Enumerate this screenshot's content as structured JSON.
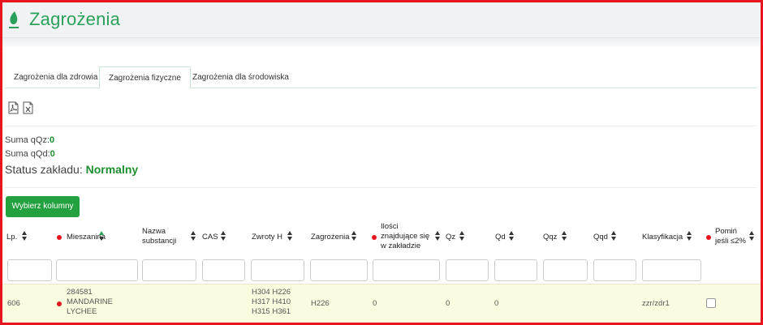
{
  "page": {
    "title": "Zagrożenia"
  },
  "tabs": [
    {
      "label": "Zagrożenia dla zdrowia",
      "active": false
    },
    {
      "label": "Zagrożenia fizyczne",
      "active": true
    },
    {
      "label": "Zagrożenia dla środowiska",
      "active": false
    }
  ],
  "toolbar": {
    "pdf_icon": "pdf-file-icon",
    "excel_icon": "excel-file-icon"
  },
  "summary": {
    "qqz_label": "Suma qQz:",
    "qqz_value": "0",
    "qqd_label": "Suma qQd:",
    "qqd_value": "0",
    "status_label": "Status zakładu:",
    "status_value": "Normalny"
  },
  "buttons": {
    "choose_columns": "Wybierz kolumny"
  },
  "table": {
    "columns": [
      {
        "label": "Lp."
      },
      {
        "label": "Mieszanina"
      },
      {
        "label_line1": "Nazwa",
        "label_line2": "substancji"
      },
      {
        "label": "CAS"
      },
      {
        "label": "Zwroty H"
      },
      {
        "label": "Zagrożenia"
      },
      {
        "label_line1": "Ilości",
        "label_line2": "znajdujące się",
        "label_line3": "w zakładzie"
      },
      {
        "label": "Qz"
      },
      {
        "label": "Qd"
      },
      {
        "label": "Qqz"
      },
      {
        "label": "Qqd"
      },
      {
        "label": "Klasyfikacja"
      },
      {
        "label_line1": "Pomiń",
        "label_line2": "jeśli ≤2%"
      }
    ],
    "rows": [
      {
        "lp": "606",
        "mieszanina_line1": "284581",
        "mieszanina_line2": "MANDARINE",
        "mieszanina_line3": "LYCHEE",
        "zwroty_line1": "H304 H226",
        "zwroty_line2": "H317 H410",
        "zwroty_line3": "H315 H361",
        "zagrozenia": "H226",
        "ilosci": "0",
        "qz": "0",
        "qd": "0",
        "klasyfikacja": "zzr/zdr1",
        "pomin_checked": false
      }
    ]
  },
  "colors": {
    "accent_green": "#2aa15a",
    "button_green": "#23a03f",
    "status_green": "#1f8f2f",
    "warning_red": "#e8141e",
    "row_highlight": "#fbfbe0"
  }
}
